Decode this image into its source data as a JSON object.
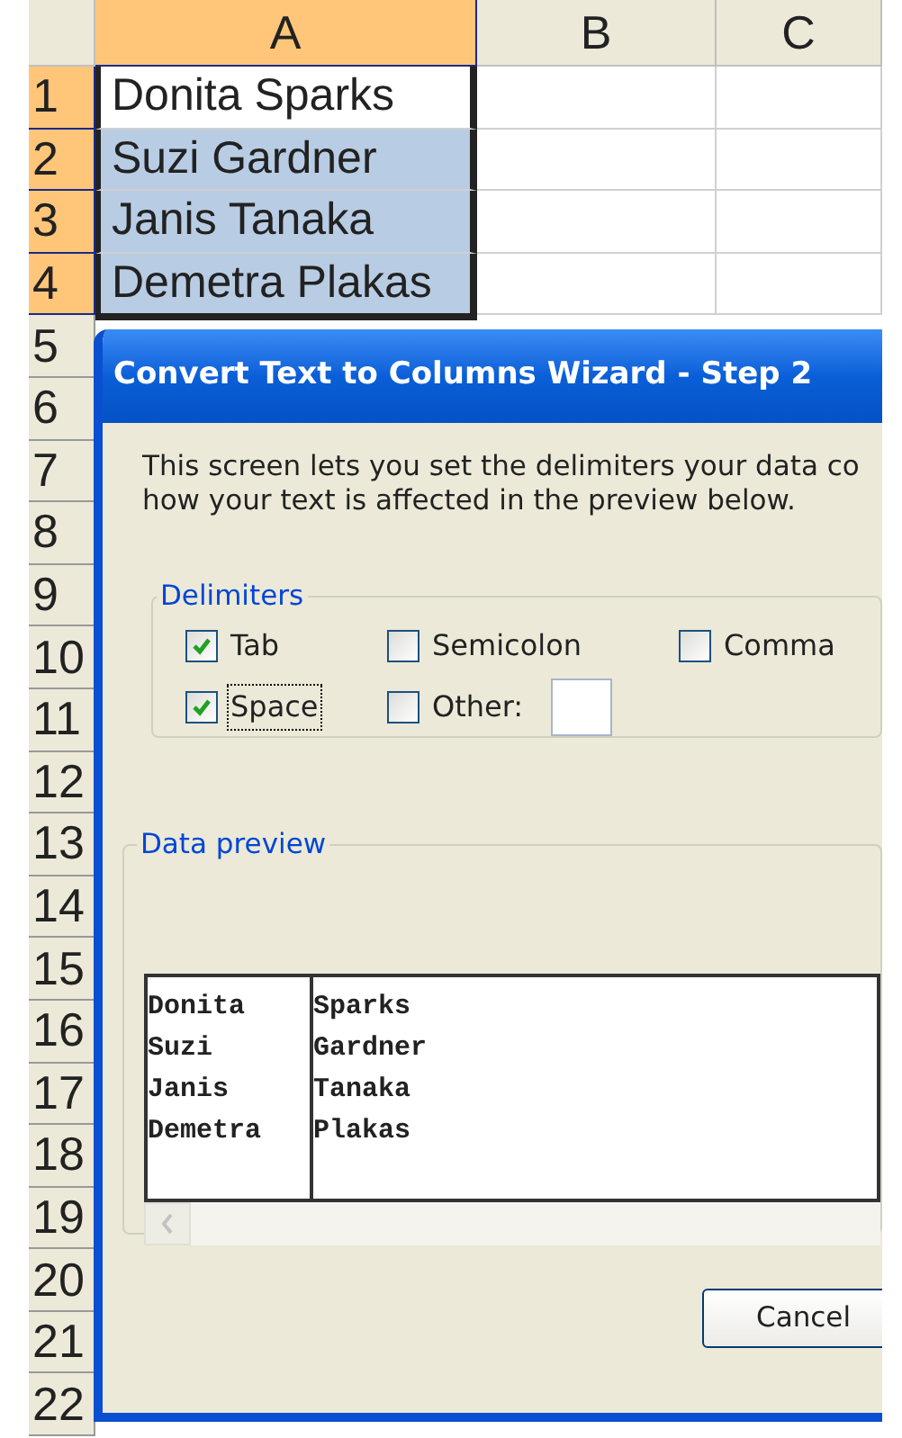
{
  "sheet": {
    "columns": [
      {
        "label": "A",
        "selected": true
      },
      {
        "label": "B",
        "selected": false
      },
      {
        "label": "C",
        "selected": false
      }
    ],
    "rows": [
      {
        "number": "1",
        "selected": true,
        "cells": [
          {
            "text": "Donita Sparks",
            "selected": true,
            "active": true
          }
        ]
      },
      {
        "number": "2",
        "selected": true,
        "cells": [
          {
            "text": "Suzi Gardner",
            "selected": true,
            "active": false
          }
        ]
      },
      {
        "number": "3",
        "selected": true,
        "cells": [
          {
            "text": "Janis Tanaka",
            "selected": true,
            "active": false
          }
        ]
      },
      {
        "number": "4",
        "selected": true,
        "cells": [
          {
            "text": "Demetra Plakas",
            "selected": true,
            "active": false
          }
        ]
      },
      {
        "number": "5",
        "selected": false
      },
      {
        "number": "6",
        "selected": false
      },
      {
        "number": "7",
        "selected": false
      },
      {
        "number": "8",
        "selected": false
      },
      {
        "number": "9",
        "selected": false
      },
      {
        "number": "10",
        "selected": false
      },
      {
        "number": "11",
        "selected": false
      },
      {
        "number": "12",
        "selected": false
      },
      {
        "number": "13",
        "selected": false
      },
      {
        "number": "14",
        "selected": false
      },
      {
        "number": "15",
        "selected": false
      },
      {
        "number": "16",
        "selected": false
      },
      {
        "number": "17",
        "selected": false
      },
      {
        "number": "18",
        "selected": false
      },
      {
        "number": "19",
        "selected": false
      },
      {
        "number": "20",
        "selected": false
      },
      {
        "number": "21",
        "selected": false
      },
      {
        "number": "22",
        "selected": false
      }
    ]
  },
  "dialog": {
    "title": "Convert Text to Columns Wizard - Step 2",
    "intro": [
      "This screen lets you set the delimiters your data co",
      "how your text is affected in the preview below."
    ],
    "delimiters": {
      "legend": "Delimiters",
      "options": [
        {
          "label": "Tab",
          "kind": "checkbox",
          "checked": true,
          "focused": false
        },
        {
          "label": "Semicolon",
          "kind": "checkbox",
          "checked": false,
          "focused": false
        },
        {
          "label": "Comma",
          "kind": "checkbox",
          "checked": false,
          "focused": false
        },
        {
          "label": "Space",
          "kind": "checkbox",
          "checked": true,
          "focused": true
        },
        {
          "label": "Other:",
          "kind": "checkbox_with_field",
          "checked": false,
          "focused": false
        }
      ]
    },
    "preview": {
      "legend": "Data preview",
      "columns": [
        [
          "Donita",
          "Suzi",
          "Janis",
          "Demetra"
        ],
        [
          "Sparks",
          "Gardner",
          "Tanaka",
          "Plakas"
        ]
      ]
    },
    "buttons": [
      "Cancel"
    ]
  }
}
